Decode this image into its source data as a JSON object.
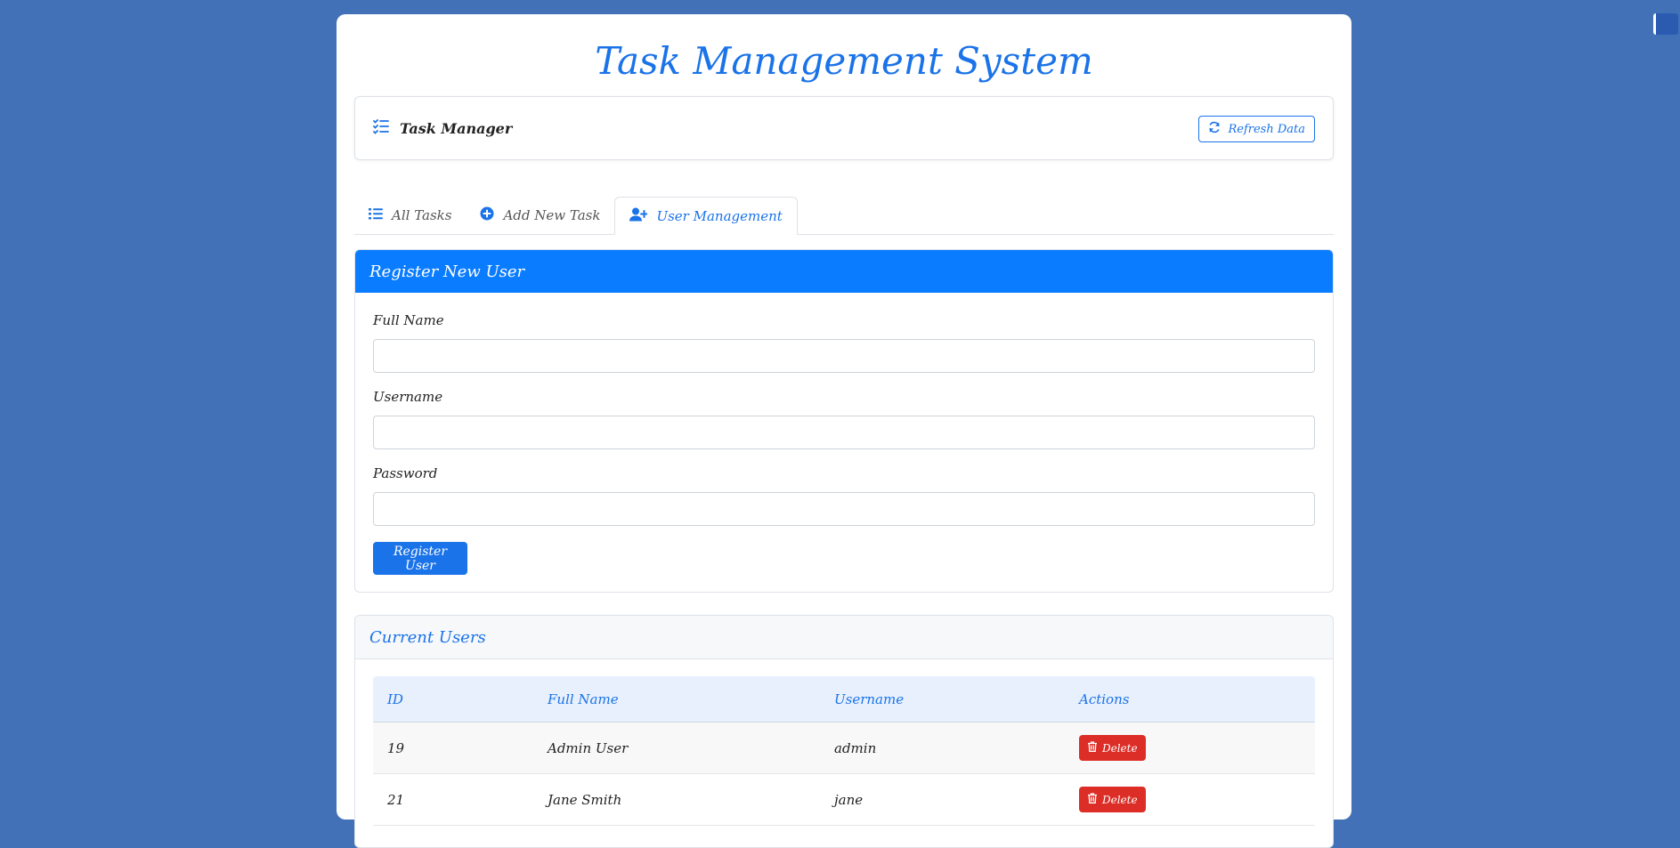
{
  "app": {
    "title": "Task Management System"
  },
  "navbar": {
    "brand": "Task Manager",
    "refresh_label": "Refresh Data"
  },
  "tabs": [
    {
      "label": "All Tasks",
      "icon": "list-icon",
      "active": false
    },
    {
      "label": "Add New Task",
      "icon": "plus-circle-icon",
      "active": false
    },
    {
      "label": "User Management",
      "icon": "user-plus-icon",
      "active": true
    }
  ],
  "register": {
    "heading": "Register New User",
    "fields": [
      {
        "label": "Full Name",
        "value": ""
      },
      {
        "label": "Username",
        "value": ""
      },
      {
        "label": "Password",
        "value": ""
      }
    ],
    "submit_label": "Register User"
  },
  "users": {
    "heading": "Current Users",
    "columns": [
      "ID",
      "Full Name",
      "Username",
      "Actions"
    ],
    "rows": [
      {
        "id": "19",
        "full_name": "Admin User",
        "username": "admin",
        "action": "Delete"
      },
      {
        "id": "21",
        "full_name": "Jane Smith",
        "username": "jane",
        "action": "Delete"
      }
    ]
  },
  "colors": {
    "background": "#4371b8",
    "primary": "#1a73e8",
    "header_blue": "#0a7cff",
    "danger": "#dc2e26"
  }
}
